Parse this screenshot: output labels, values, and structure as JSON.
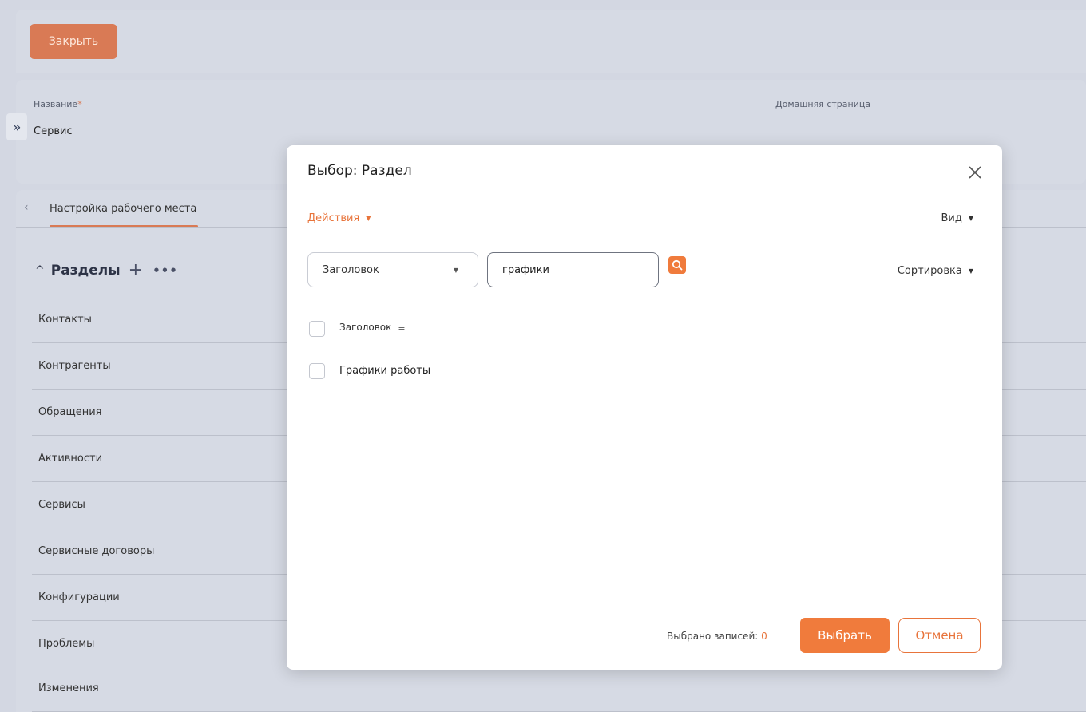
{
  "toolbar": {
    "close_label": "Закрыть"
  },
  "form": {
    "name_label": "Название",
    "name_required_mark": "*",
    "name_value": "Сервис",
    "home_page_label": "Домашняя страница"
  },
  "tabs": {
    "workplace_tab": "Настройка рабочего места"
  },
  "sections": {
    "title": "Разделы",
    "items": [
      "Контакты",
      "Контрагенты",
      "Обращения",
      "Активности",
      "Сервисы",
      "Сервисные договоры",
      "Конфигурации",
      "Проблемы",
      "Изменения"
    ]
  },
  "modal": {
    "title": "Выбор: Раздел",
    "actions_label": "Действия",
    "view_label": "Вид",
    "filter_column": "Заголовок",
    "search_value": "графики",
    "sort_label": "Сортировка",
    "column_header": "Заголовок",
    "rows": [
      "Графики работы"
    ],
    "selected_label": "Выбрано записей:",
    "selected_count": "0",
    "select_button": "Выбрать",
    "cancel_button": "Отмена"
  },
  "colors": {
    "accent": "#f07b3c",
    "close_button": "#d97a55",
    "background": "#d3d7e2"
  }
}
